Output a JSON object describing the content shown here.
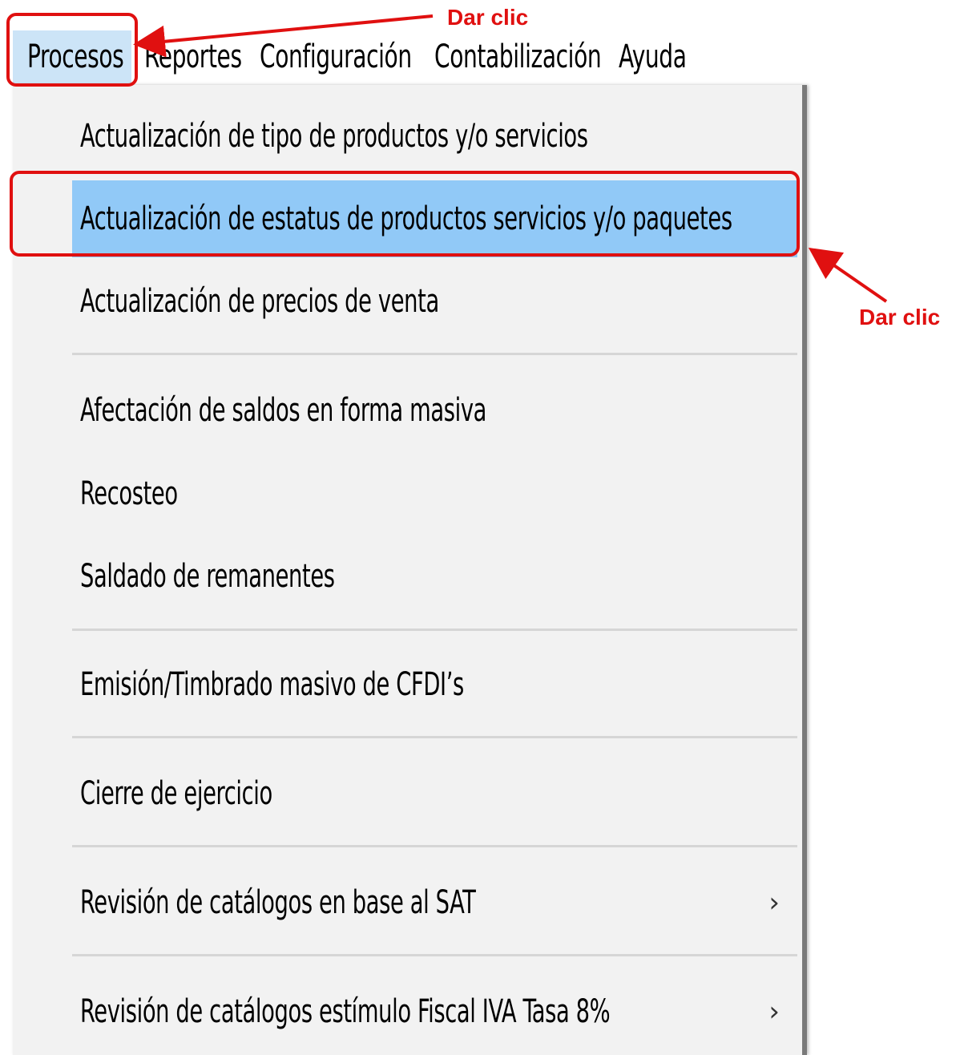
{
  "menubar": {
    "items": [
      {
        "label": "Procesos"
      },
      {
        "label": "Reportes"
      },
      {
        "label": "Configuración"
      },
      {
        "label": "Contabilización"
      },
      {
        "label": "Ayuda"
      }
    ]
  },
  "dropdown": {
    "items": [
      {
        "label": "Actualización de tipo de productos y/o servicios"
      },
      {
        "label": "Actualización de estatus de productos servicios y/o paquetes"
      },
      {
        "label": "Actualización de precios de venta"
      },
      {
        "label": "Afectación de saldos en forma masiva"
      },
      {
        "label": "Recosteo"
      },
      {
        "label": "Saldado de remanentes"
      },
      {
        "label": "Emisión/Timbrado masivo de CFDI’s"
      },
      {
        "label": "Cierre de ejercicio"
      },
      {
        "label": "Revisión de catálogos en base al SAT",
        "submenu_icon": "chevron-right-icon"
      },
      {
        "label": "Revisión de catálogos estímulo Fiscal IVA Tasa 8%",
        "submenu_icon": "chevron-right-icon"
      }
    ],
    "highlighted_item": "Actualización de estatus de productos servicios y/o paquetes",
    "highlight_color": "#91c9f7",
    "submenu_glyph": "›"
  },
  "annotations": {
    "top_note": "Dar clic",
    "side_note": "Dar clic",
    "color": "#e01010"
  }
}
